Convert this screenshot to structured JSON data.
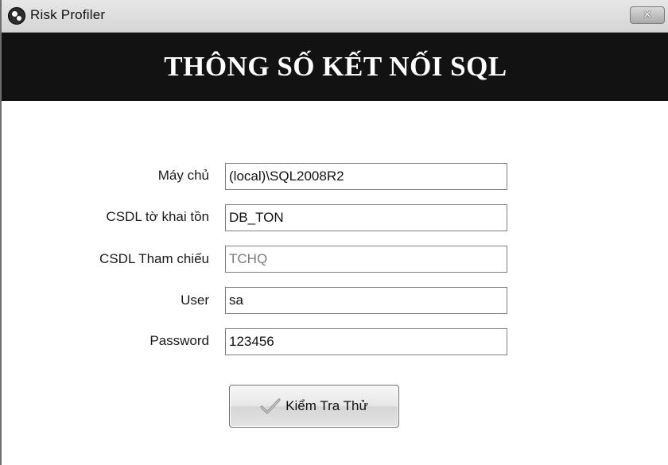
{
  "window": {
    "title": "Risk Profiler",
    "close_symbol": "✕"
  },
  "banner": {
    "title": "THÔNG SỐ KẾT NỐI SQL"
  },
  "form": {
    "fields": [
      {
        "label": "Máy chủ",
        "value": "(local)\\SQL2008R2"
      },
      {
        "label": "CSDL tờ khai tồn",
        "value": "DB_TON"
      },
      {
        "label": "CSDL Tham chiếu",
        "value": "TCHQ"
      },
      {
        "label": "User",
        "value": "sa"
      },
      {
        "label": "Password",
        "value": "123456"
      }
    ]
  },
  "actions": {
    "test_label": "Kiểm Tra Thử",
    "test_icon": "checkmark-icon"
  }
}
